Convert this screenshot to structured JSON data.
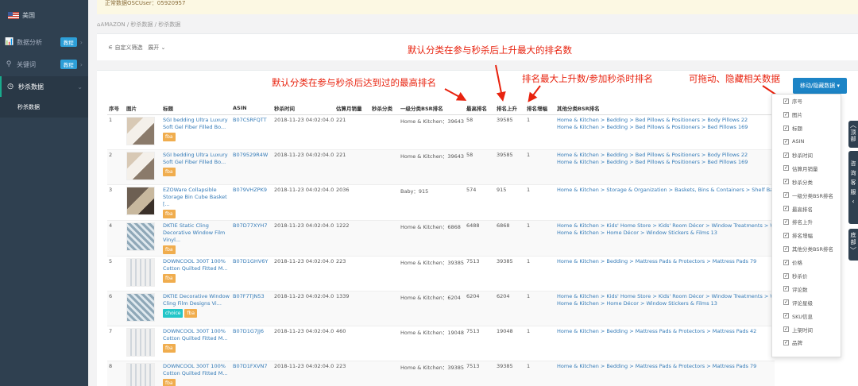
{
  "sidebar": {
    "flag_label": "美国",
    "items": [
      {
        "label": "数据分析",
        "badge": "教程"
      },
      {
        "label": "关键词",
        "badge": "教程"
      },
      {
        "label": "秒杀数据"
      }
    ],
    "sub_item": "秒杀数据"
  },
  "notice": "正常数据OSCUser：05920957",
  "breadcrumb": "AMAZON  /  秒杀数据  /  秒杀数据",
  "filter": {
    "label": "自定义筛选",
    "toggle": "展开"
  },
  "annotations": {
    "a1": "默认分类在参与秒杀后上升最大的排名数",
    "a2": "默认分类在参与秒杀后达到过的最高排名",
    "a3": "排名最大上升数/参加秒杀时排名",
    "a4": "可拖动、隐藏相关数据"
  },
  "col_button": "移动/隐藏数据 ▾",
  "headers": [
    "序号",
    "图片",
    "标题",
    "ASIN",
    "秒杀时间",
    "估算月销量",
    "秒杀分类",
    "一级分类BSR排名",
    "最高排名",
    "排名上升",
    "排名增幅",
    "其他分类BSR排名"
  ],
  "rows": [
    {
      "idx": "1",
      "title": "SGI bedding Ultra Luxury Soft Gel Fiber Filled Bo...",
      "asin": "B07CSRFQTT",
      "time": "2018-11-23 04:02:04.0",
      "sales": "221",
      "cat": "",
      "bsr": "Home & Kitchen：39643",
      "high": "58",
      "rise": "39585",
      "inc": "1",
      "other": "Home & Kitchen > Bedding > Bed Pillows & Positioners > Body Pillows 22\nHome & Kitchen > Bedding > Bed Pillows & Positioners > Bed Pillows 169",
      "tags": [
        "fba"
      ]
    },
    {
      "idx": "2",
      "title": "SGI bedding Ultra Luxury Soft Gel Fiber Filled Bo...",
      "asin": "B079529R4W",
      "time": "2018-11-23 04:02:04.0",
      "sales": "221",
      "cat": "",
      "bsr": "Home & Kitchen：39643",
      "high": "58",
      "rise": "39585",
      "inc": "1",
      "other": "Home & Kitchen > Bedding > Bed Pillows & Positioners > Body Pillows 22\nHome & Kitchen > Bedding > Bed Pillows & Positioners > Bed Pillows 169",
      "tags": [
        "fba"
      ]
    },
    {
      "idx": "3",
      "title": "EZOWare Collapsible Storage Bin Cube Basket [...",
      "asin": "B079VHZPK9",
      "time": "2018-11-23 04:02:04.0",
      "sales": "2036",
      "cat": "",
      "bsr": "Baby：915",
      "high": "574",
      "rise": "915",
      "inc": "1",
      "other": "Home & Kitchen > Storage & Organization > Baskets, Bins & Containers > Shelf Baskets",
      "tags": [
        "fba"
      ]
    },
    {
      "idx": "4",
      "title": "DKTIE Static Cling Decorative Window Film Vinyl...",
      "asin": "B07D77XYH7",
      "time": "2018-11-23 04:02:04.0",
      "sales": "1222",
      "cat": "",
      "bsr": "Home & Kitchen：6868",
      "high": "6488",
      "rise": "6868",
      "inc": "1",
      "other": "Home & Kitchen > Kids' Home Store > Kids' Room Décor > Window Treatments > Window\nHome & Kitchen > Home Décor > Window Stickers & Films 13",
      "tags": [
        "fba"
      ]
    },
    {
      "idx": "5",
      "title": "DOWNCOOL 300T 100% Cotton Quilted Fitted M...",
      "asin": "B07D1GHV6Y",
      "time": "2018-11-23 04:02:04.0",
      "sales": "223",
      "cat": "",
      "bsr": "Home & Kitchen：39385",
      "high": "7513",
      "rise": "39385",
      "inc": "1",
      "other": "Home & Kitchen > Bedding > Mattress Pads & Protectors > Mattress Pads 79",
      "tags": [
        "fba"
      ]
    },
    {
      "idx": "6",
      "title": "DKTIE Decorative Window Cling Film Designs Vi...",
      "asin": "B07F7TJN53",
      "time": "2018-11-23 04:02:04.0",
      "sales": "1339",
      "cat": "",
      "bsr": "Home & Kitchen：6204",
      "high": "6204",
      "rise": "6204",
      "inc": "1",
      "other": "Home & Kitchen > Kids' Home Store > Kids' Room Décor > Window Treatments > Window\nHome & Kitchen > Home Décor > Window Stickers & Films 13",
      "tags": [
        "choice",
        "fba"
      ]
    },
    {
      "idx": "7",
      "title": "DOWNCOOL 300T 100% Cotton Quilted Fitted M...",
      "asin": "B07D1G7JJ6",
      "time": "2018-11-23 04:02:04.0",
      "sales": "460",
      "cat": "",
      "bsr": "Home & Kitchen：19048",
      "high": "7513",
      "rise": "19048",
      "inc": "1",
      "other": "Home & Kitchen > Bedding > Mattress Pads & Protectors > Mattress Pads 42",
      "tags": [
        "fba"
      ]
    },
    {
      "idx": "8",
      "title": "DOWNCOOL 300T 100% Cotton Quilted Fitted M...",
      "asin": "B07D1FXVN7",
      "time": "2018-11-23 04:02:04.0",
      "sales": "223",
      "cat": "",
      "bsr": "Home & Kitchen：39385",
      "high": "7513",
      "rise": "39385",
      "inc": "1",
      "other": "Home & Kitchen > Bedding > Mattress Pads & Protectors > Mattress Pads 79",
      "tags": [
        "fba"
      ]
    }
  ],
  "column_options": [
    "序号",
    "图片",
    "标题",
    "ASIN",
    "秒杀时间",
    "估算月销量",
    "秒杀分类",
    "一级分类BSR排名",
    "最高排名",
    "排名上升",
    "排名增幅",
    "其他分类BSR排名",
    "价格",
    "秒杀价",
    "评论数",
    "评论星级",
    "SKU信息",
    "上架时间",
    "品牌"
  ],
  "side_tabs": [
    "顶部",
    "咨询客服",
    "底部"
  ]
}
